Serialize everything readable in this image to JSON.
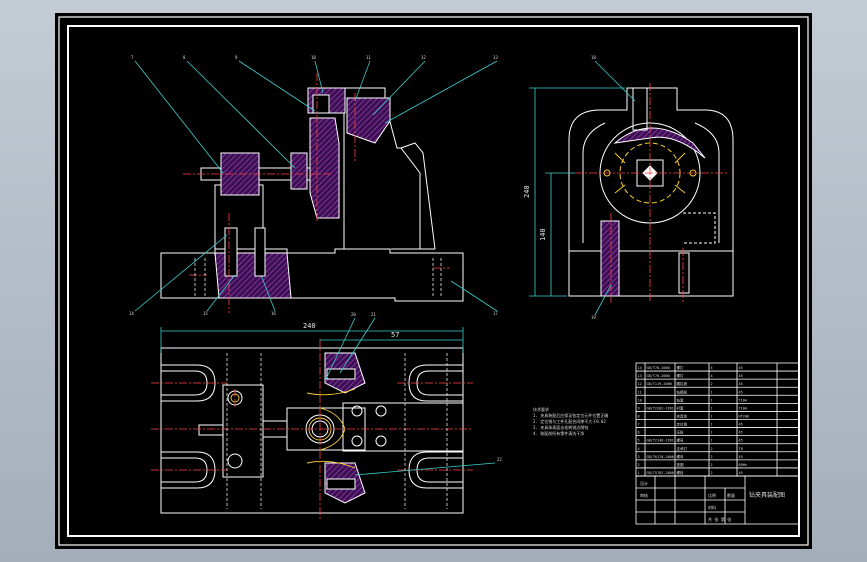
{
  "drawing": {
    "dimensions": {
      "top_width": "240",
      "top_right": "57",
      "side_height": "240",
      "side_height_inner": "140"
    },
    "leader_labels": [
      "7",
      "8",
      "9",
      "10",
      "11",
      "12",
      "13",
      "14",
      "15",
      "16",
      "17",
      "18",
      "19",
      "20",
      "21",
      "22"
    ],
    "notes": [
      "技术要求",
      "1. 夹具装配后应保证各定位元件位置正确",
      "2. 定位销与工件孔配合间隙不大于0.02",
      "3. 夹具体表面去毛刺锐边倒钝",
      "4. 装配前所有零件清洗干净"
    ],
    "title_block": {
      "name": "钻夹具装配图",
      "scale": "比例",
      "qty": "数量",
      "designer": "设计",
      "checker": "审核",
      "material": "材料",
      "sheet": "共 张 第 张"
    },
    "bom_rows": [
      [
        "14",
        "GB/T70-2000",
        "螺钉",
        "4",
        "45"
      ],
      [
        "13",
        "GB/T70-2000",
        "螺钉",
        "4",
        "45"
      ],
      [
        "12",
        "GB/T119-2000",
        "圆柱销",
        "2",
        "45"
      ],
      [
        "11",
        "",
        "钻模板",
        "1",
        "45"
      ],
      [
        "10",
        "",
        "钻套",
        "1",
        "T10A"
      ],
      [
        "9",
        "GB/T2262-1991",
        "衬套",
        "1",
        "T10A"
      ],
      [
        "8",
        "",
        "夹具体",
        "1",
        "HT200"
      ],
      [
        "7",
        "",
        "定位销",
        "1",
        "45"
      ],
      [
        "6",
        "",
        "压板",
        "1",
        "45"
      ],
      [
        "5",
        "GB/T2148-1991",
        "螺母",
        "1",
        "45"
      ],
      [
        "4",
        "",
        "支承钉",
        "2",
        "T8"
      ],
      [
        "3",
        "GB/T6170-2000",
        "螺母",
        "2",
        "45"
      ],
      [
        "2",
        "",
        "垫圈",
        "2",
        "65Mn"
      ],
      [
        "1",
        "GB/T5782-2000",
        "螺栓",
        "2",
        "45"
      ]
    ]
  }
}
